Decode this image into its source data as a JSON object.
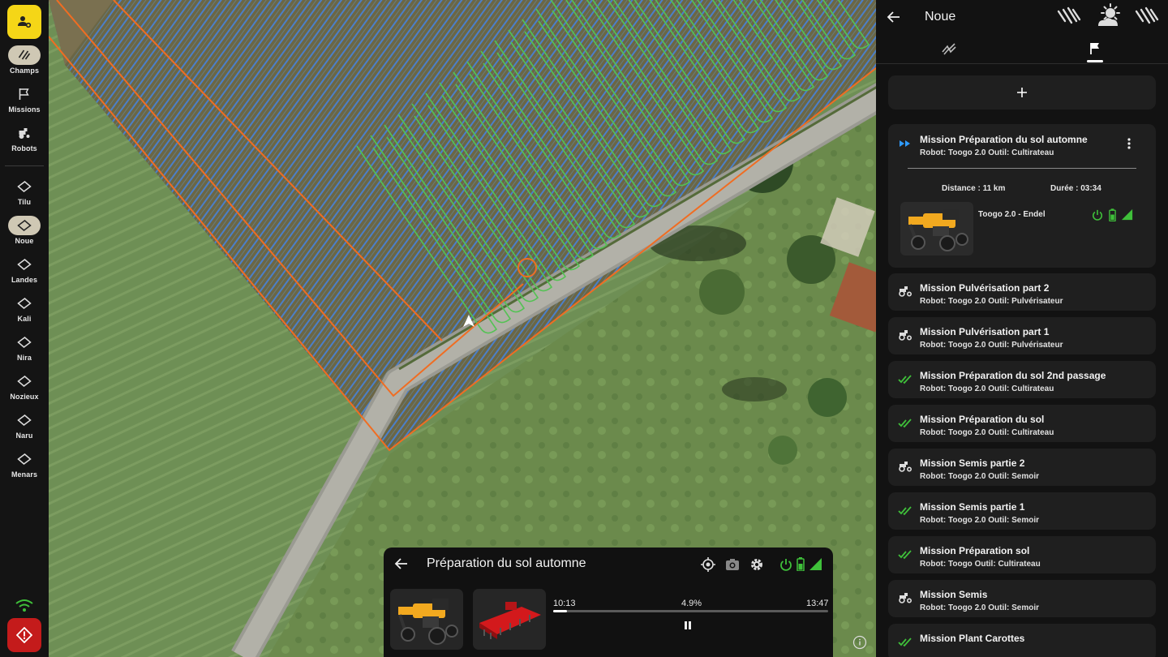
{
  "rail": {
    "items": [
      {
        "label": "Champs",
        "icon": "fields-icon"
      },
      {
        "label": "Missions",
        "icon": "flag-icon"
      },
      {
        "label": "Robots",
        "icon": "tractor-icon"
      },
      {
        "label": "Tilu",
        "icon": "field-shape-icon"
      },
      {
        "label": "Noue",
        "icon": "field-shape-icon",
        "selected": true
      },
      {
        "label": "Landes",
        "icon": "field-shape-icon"
      },
      {
        "label": "Kali",
        "icon": "field-shape-icon"
      },
      {
        "label": "Nira",
        "icon": "field-shape-icon"
      },
      {
        "label": "Nozieux",
        "icon": "field-shape-icon"
      },
      {
        "label": "Naru",
        "icon": "field-shape-icon"
      },
      {
        "label": "Menars",
        "icon": "field-shape-icon"
      }
    ]
  },
  "colors": {
    "accent_yellow": "#f5d617",
    "alert_red": "#c41b1b",
    "status_green": "#3fc03a",
    "active_blue": "#2f9bff",
    "path_orange": "#f06d22",
    "path_green": "#54c254",
    "path_blue": "#4f86d8"
  },
  "mission_card": {
    "title": "Préparation du sol automne",
    "time_start": "10:13",
    "progress_label": "4.9%",
    "progress": 0.049,
    "time_end": "13:47"
  },
  "panel": {
    "title": "Noue",
    "active_mission": {
      "name": "Mission Préparation du sol automne",
      "subtitle": "Robot: Toogo 2.0  Outil: Cultirateau",
      "distance": "Distance : 11 km",
      "duration": "Durée : 03:34",
      "robot_name": "Toogo 2.0 - Endel"
    },
    "missions": [
      {
        "name": "Mission Pulvérisation part 2",
        "subtitle": "Robot: Toogo 2.0  Outil: Pulvérisateur",
        "status": "pending"
      },
      {
        "name": "Mission Pulvérisation part 1",
        "subtitle": "Robot: Toogo 2.0  Outil: Pulvérisateur",
        "status": "pending"
      },
      {
        "name": "Mission Préparation du sol 2nd passage",
        "subtitle": "Robot: Toogo 2.0  Outil: Cultirateau",
        "status": "done"
      },
      {
        "name": "Mission Préparation du sol",
        "subtitle": "Robot: Toogo 2.0  Outil: Cultirateau",
        "status": "done"
      },
      {
        "name": "Mission Semis partie 2",
        "subtitle": "Robot: Toogo 2.0  Outil: Semoir",
        "status": "pending"
      },
      {
        "name": "Mission Semis partie 1",
        "subtitle": "Robot: Toogo 2.0  Outil: Semoir",
        "status": "done"
      },
      {
        "name": "Mission Préparation sol",
        "subtitle": "Robot: Toogo  Outil: Cultirateau",
        "status": "done"
      },
      {
        "name": "Mission Semis",
        "subtitle": "Robot: Toogo 2.0  Outil: Semoir",
        "status": "pending"
      },
      {
        "name": "Mission Plant Carottes",
        "subtitle": "",
        "status": "done"
      }
    ]
  }
}
